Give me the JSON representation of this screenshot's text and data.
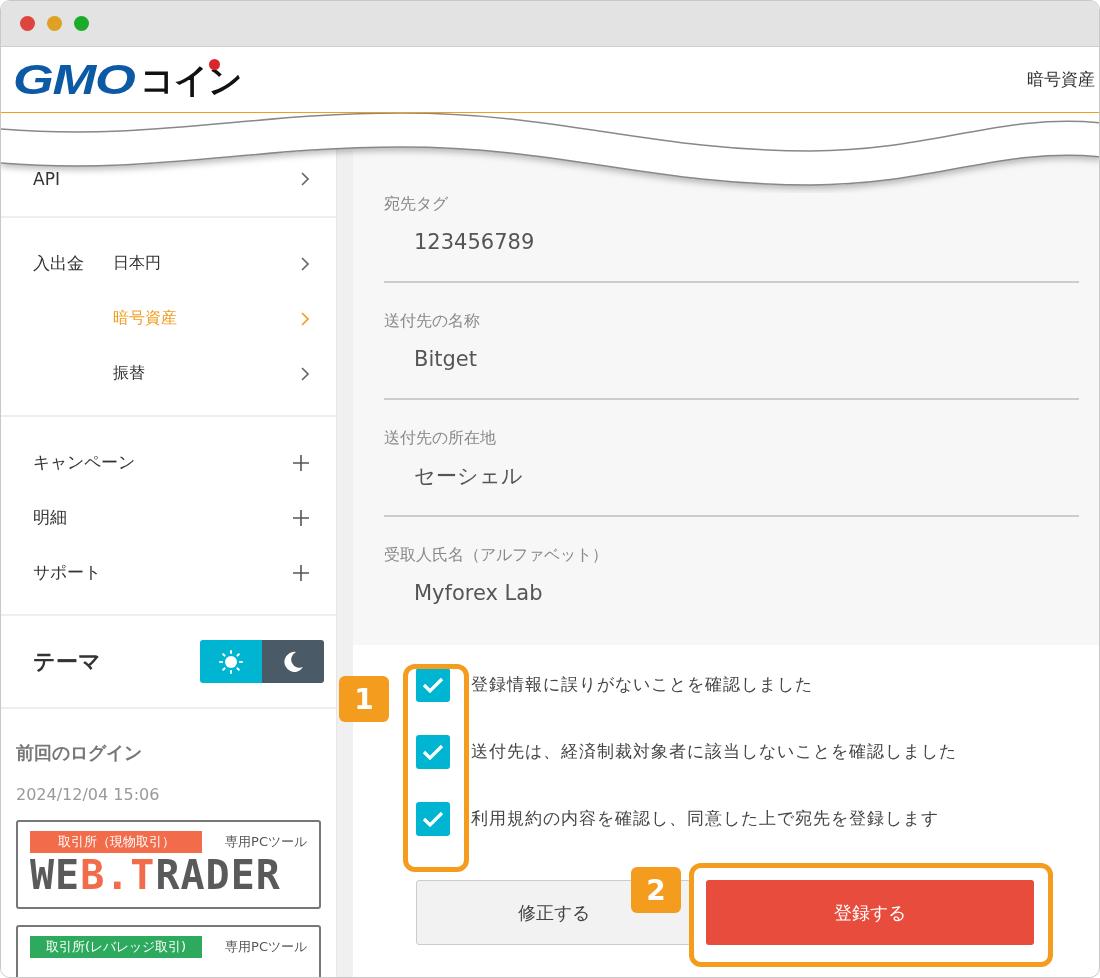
{
  "window": {
    "controls": [
      {
        "kind": "close"
      },
      {
        "kind": "minimize"
      },
      {
        "kind": "zoom"
      }
    ]
  },
  "header": {
    "logo": {
      "text_1": "GMO",
      "text_2": "コイン"
    },
    "nav_text": "暗号資産"
  },
  "sidebar": {
    "groups": [
      {
        "items": [
          {
            "label": "API",
            "kind": "link"
          }
        ]
      },
      {
        "items": [
          {
            "label": "入出金",
            "children": [
              {
                "label": "日本円",
                "selected": false
              },
              {
                "label": "暗号資産",
                "selected": true
              },
              {
                "label": "振替",
                "selected": false
              }
            ]
          }
        ]
      },
      {
        "items": [
          {
            "label": "キャンペーン",
            "kind": "expandable"
          },
          {
            "label": "明細",
            "kind": "expandable"
          },
          {
            "label": "サポート",
            "kind": "expandable"
          }
        ]
      }
    ],
    "theme": {
      "label": "テーマ",
      "options": [
        {
          "kind": "light",
          "selected": true
        },
        {
          "kind": "dark",
          "selected": false
        }
      ]
    },
    "last_login": {
      "title": "前回のログイン",
      "time": "2024/12/04 15:06"
    },
    "banners": [
      {
        "tag": "取引所（現物取引）",
        "color": "#f26b4a",
        "note": "専用PCツール",
        "logo": [
          {
            "text": "WE",
            "accent": false
          },
          {
            "text": "B.T",
            "accent": true
          },
          {
            "text": "RADER",
            "accent": false
          }
        ]
      },
      {
        "tag": "取引所(レバレッジ取引)",
        "color": "#2eaa5e",
        "note": "専用PCツール"
      }
    ]
  },
  "details": [
    {
      "label": "宛先タグ",
      "value": "123456789"
    },
    {
      "label": "送付先の名称",
      "value": "Bitget"
    },
    {
      "label": "送付先の所在地",
      "value": "セーシェル"
    },
    {
      "label": "受取人氏名（アルファベット）",
      "value": "Myforex Lab"
    }
  ],
  "confirmations": [
    {
      "label": "登録情報に誤りがないことを確認しました",
      "checked": true
    },
    {
      "label": "送付先は、経済制裁対象者に該当しないことを確認しました",
      "checked": true
    },
    {
      "label": "利用規約の内容を確認し、同意した上で宛先を登録します",
      "checked": true
    }
  ],
  "buttons": [
    {
      "label": "修正する",
      "kind": "secondary"
    },
    {
      "label": "登録する",
      "kind": "primary"
    }
  ],
  "annotations": [
    {
      "number": "1"
    },
    {
      "number": "2"
    }
  ]
}
